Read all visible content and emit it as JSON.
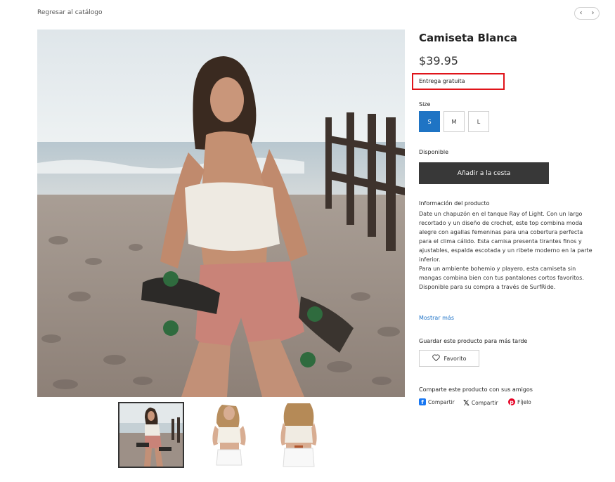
{
  "nav": {
    "back_label": "Regresar al catálogo",
    "prev_icon": "chevron-left-icon",
    "next_icon": "chevron-right-icon"
  },
  "product": {
    "title": "Camiseta Blanca",
    "price": "$39.95",
    "shipping": "Entrega gratuita",
    "size_label": "Size",
    "sizes": [
      "S",
      "M",
      "L"
    ],
    "selected_size": "S",
    "availability": "Disponible",
    "add_to_cart": "Añadir a la cesta",
    "info_title": "Información del producto",
    "description_1": "Date un chapuzón en el tanque Ray of Light. Con un largo recortado y un diseño de crochet, este top combina moda alegre con agallas femeninas para una cobertura perfecta para el clima cálido. Esta camisa presenta tirantes finos y ajustables, espalda escotada y un ribete moderno en la parte inferior.",
    "description_2": "Para un ambiente bohemio y playero, esta camiseta sin mangas combina bien con tus pantalones cortos favoritos. Disponible para su compra a través de SurfRide.",
    "show_more": "Mostrar más",
    "save_label": "Guardar este producto para más tarde",
    "favorite": "Favorito",
    "share_label": "Comparte este producto con sus amigos",
    "share_facebook": "Compartir",
    "share_x": "Compartir",
    "share_pinterest": "Fíjelo"
  },
  "colors": {
    "accent": "#1f74c4",
    "dark_button": "#383838",
    "highlight": "#e0141a",
    "link": "#2074c8"
  }
}
